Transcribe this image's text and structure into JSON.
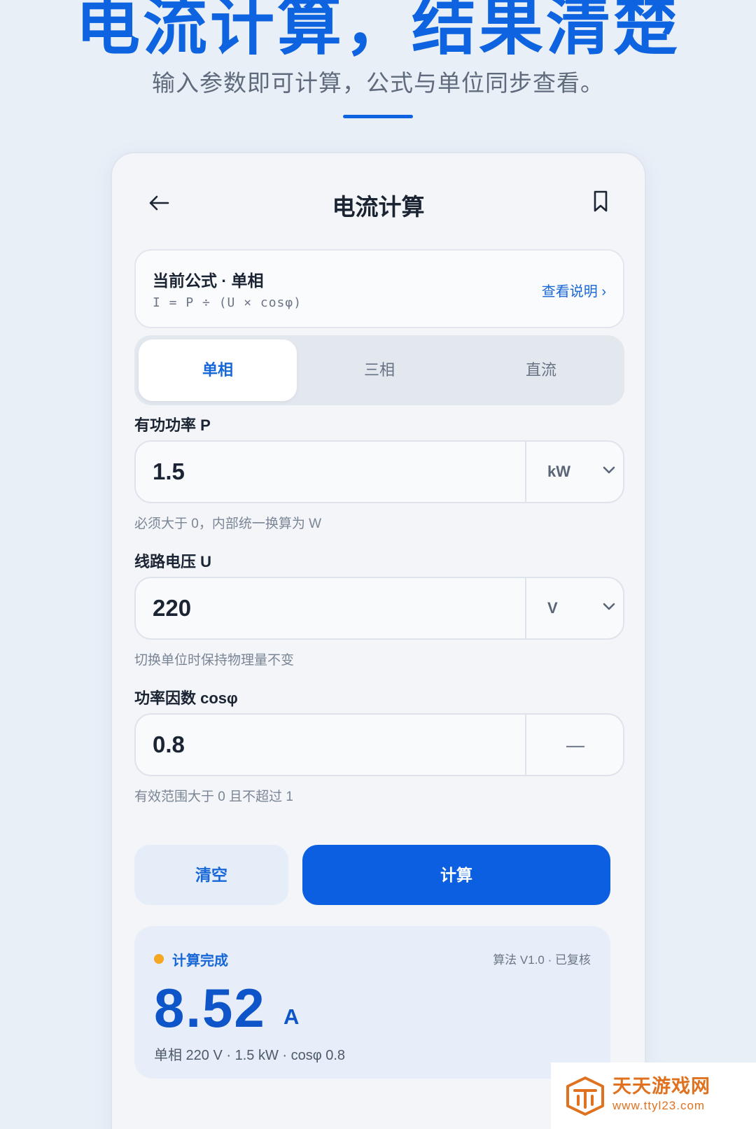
{
  "hero": {
    "title": "电流计算，结果清楚",
    "subtitle": "输入参数即可计算，公式与单位同步查看。"
  },
  "topbar": {
    "title": "电流计算",
    "back_icon": "arrow-left-icon",
    "bookmark_icon": "bookmark-icon"
  },
  "formula": {
    "title": "当前公式 · 单相",
    "expression": "I = P ÷ (U × cosφ)",
    "link": "查看说明 ›"
  },
  "tabs": [
    {
      "label": "单相",
      "active": true
    },
    {
      "label": "三相",
      "active": false
    },
    {
      "label": "直流",
      "active": false
    }
  ],
  "fields": {
    "power": {
      "label": "有功功率 P",
      "value": "1.5",
      "unit": "kW",
      "hint": "必须大于 0，内部统一换算为 W"
    },
    "voltage": {
      "label": "线路电压 U",
      "value": "220",
      "unit": "V",
      "hint": "切换单位时保持物理量不变"
    },
    "pf": {
      "label": "功率因数 cosφ",
      "value": "0.8",
      "unit": "—",
      "hint": "有效范围大于 0 且不超过 1"
    }
  },
  "buttons": {
    "clear": "清空",
    "calculate": "计算"
  },
  "result": {
    "status": "计算完成",
    "meta": "算法 V1.0 · 已复核",
    "value": "8.52",
    "unit": "A",
    "detail": "单相 220 V · 1.5 kW · cosφ 0.8"
  },
  "watermark": {
    "name": "天天游戏网",
    "url": "www.ttyl23.com"
  },
  "colors": {
    "accent": "#0b5fe0",
    "status_dot": "#f5a623",
    "watermark": "#e0721f"
  }
}
